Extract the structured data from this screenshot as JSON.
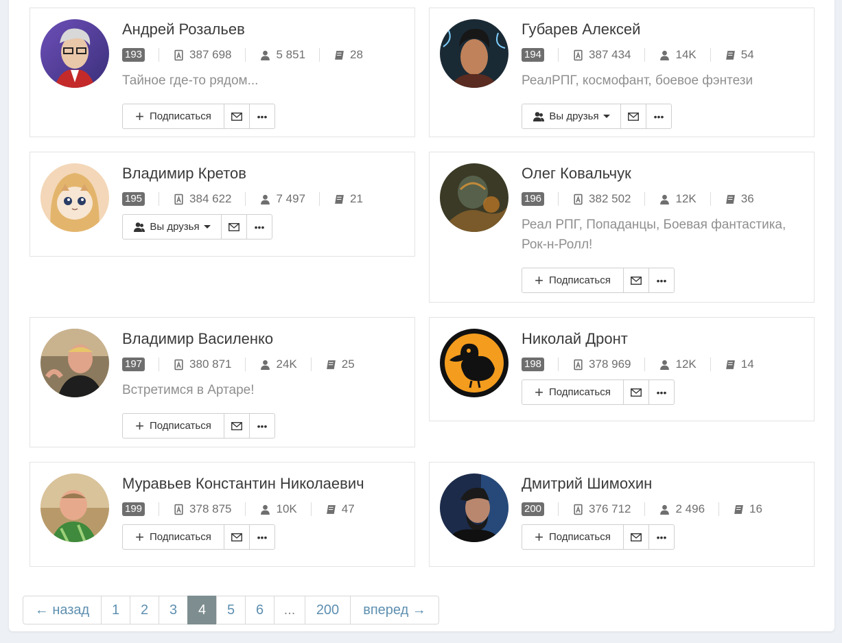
{
  "users": [
    {
      "name": "Андрей Розальев",
      "rank": "193",
      "books_total": "387 698",
      "followers": "5 851",
      "works": "28",
      "bio": "Тайное где-то рядом...",
      "action": "Подписаться"
    },
    {
      "name": "Губарев Алексей",
      "rank": "194",
      "books_total": "387 434",
      "followers": "14K",
      "works": "54",
      "bio": "РеалРПГ, космофант, боевое фэнтези",
      "action": "Вы друзья"
    },
    {
      "name": "Владимир Кретов",
      "rank": "195",
      "books_total": "384 622",
      "followers": "7 497",
      "works": "21",
      "bio": "",
      "action": "Вы друзья"
    },
    {
      "name": "Олег Ковальчук",
      "rank": "196",
      "books_total": "382 502",
      "followers": "12K",
      "works": "36",
      "bio_line1": "Реал РПГ, Попаданцы, Боевая фантастика,",
      "bio_line2": "Рок-н-Ролл!",
      "action": "Подписаться"
    },
    {
      "name": "Владимир Василенко",
      "rank": "197",
      "books_total": "380 871",
      "followers": "24K",
      "works": "25",
      "bio": "Встретимся в Артаре!",
      "action": "Подписаться"
    },
    {
      "name": "Николай Дронт",
      "rank": "198",
      "books_total": "378 969",
      "followers": "12K",
      "works": "14",
      "bio": "",
      "action": "Подписаться"
    },
    {
      "name": "Муравьев Константин Николаевич",
      "rank": "199",
      "books_total": "378 875",
      "followers": "10K",
      "works": "47",
      "bio": "",
      "action": "Подписаться"
    },
    {
      "name": "Дмитрий Шимохин",
      "rank": "200",
      "books_total": "376 712",
      "followers": "2 496",
      "works": "16",
      "bio": "",
      "action": "Подписаться"
    }
  ],
  "more_label": "•••",
  "pagination": {
    "prev": "← назад",
    "pages": [
      "1",
      "2",
      "3",
      "4",
      "5",
      "6",
      "...",
      "200"
    ],
    "current": "4",
    "next": "вперед →"
  },
  "icons": {
    "books": "book-library-icon",
    "followers": "user-icon",
    "works": "book-icon",
    "message": "envelope-icon",
    "subscribe": "plus-icon",
    "friends": "friends-icon"
  },
  "colors": {
    "rank_badge": "#6e6e6e",
    "link": "#5d8fb0",
    "active_page": "#7e8e90"
  }
}
